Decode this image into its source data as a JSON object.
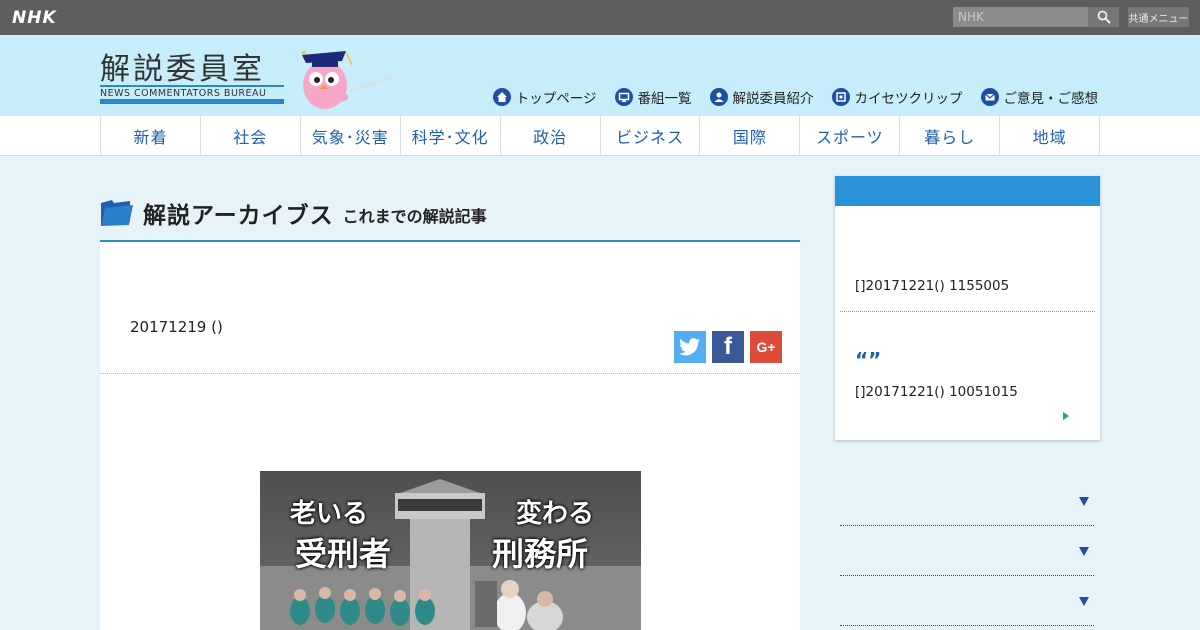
{
  "global_bar": {
    "logo": "NHK",
    "search_placeholder": "NHK",
    "common_menu_label": "共通メニュー"
  },
  "header": {
    "site_title": "解説委員室",
    "site_subtitle": "NEWS COMMENTATORS BUREAU",
    "nav": [
      {
        "label": "トップページ",
        "icon": "home-icon"
      },
      {
        "label": "番組一覧",
        "icon": "tv-icon"
      },
      {
        "label": "解説委員紹介",
        "icon": "person-icon"
      },
      {
        "label": "カイセツクリップ",
        "icon": "film-icon"
      },
      {
        "label": "ご意見・ご感想",
        "icon": "mail-icon"
      }
    ]
  },
  "categories": [
    "新着",
    "社会",
    "気象･災害",
    "科学･文化",
    "政治",
    "ビジネス",
    "国際",
    "スポーツ",
    "暮らし",
    "地域"
  ],
  "archive": {
    "title": "解説アーカイブス",
    "subtitle": "これまでの解説記事"
  },
  "article": {
    "date": "20171219 ()",
    "share": {
      "twitter": "t",
      "facebook": "f",
      "google": "G+"
    },
    "image_text": {
      "left_top": "老いる",
      "left_bottom": "受刑者",
      "right_top": "変わる",
      "right_bottom": "刑務所"
    }
  },
  "sidebar": {
    "item1_meta": "[]20171221() 1155005",
    "item2_quote": "“”",
    "item2_meta": "[]20171221() 10051015"
  },
  "colors": {
    "accent_blue": "#2a93d8",
    "header_bg": "#c7edfa",
    "nav_text": "#1f5fae",
    "page_bg": "#e6f4fa"
  }
}
